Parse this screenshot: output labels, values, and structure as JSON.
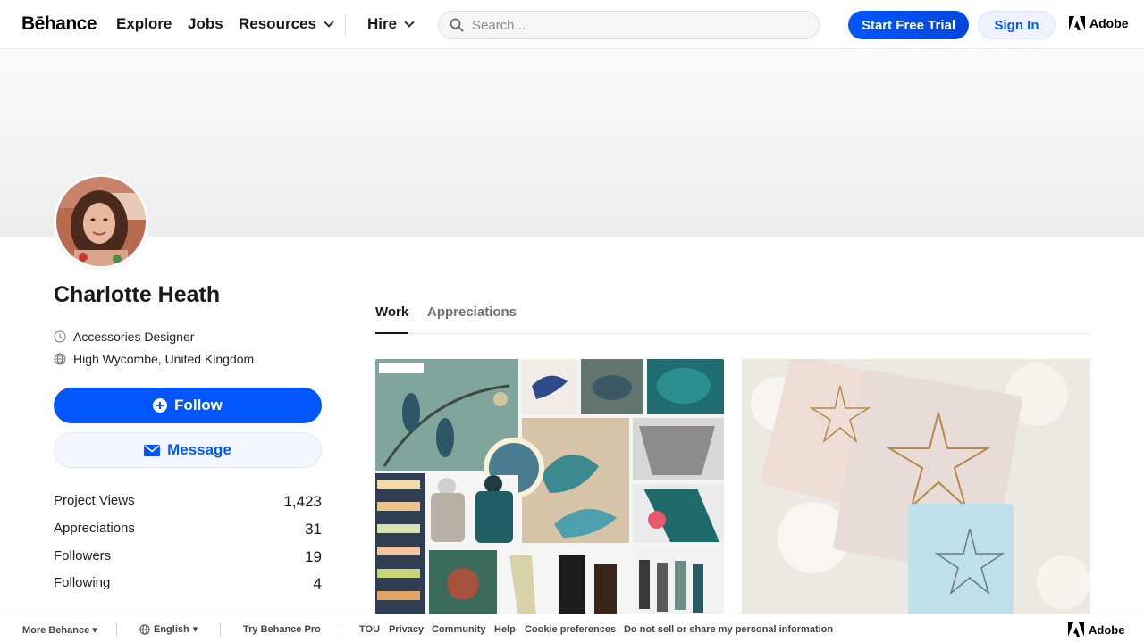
{
  "header": {
    "logo": "Bēhance",
    "nav": [
      "Explore",
      "Jobs",
      "Resources",
      "Hire"
    ],
    "search_placeholder": "Search...",
    "trial_label": "Start Free Trial",
    "signin_label": "Sign In",
    "adobe_label": "Adobe"
  },
  "profile": {
    "name": "Charlotte Heath",
    "occupation": "Accessories Designer",
    "location": "High Wycombe, United Kingdom",
    "follow_label": "Follow",
    "message_label": "Message",
    "stats": [
      {
        "label": "Project Views",
        "value": "1,423"
      },
      {
        "label": "Appreciations",
        "value": "31"
      },
      {
        "label": "Followers",
        "value": "19"
      },
      {
        "label": "Following",
        "value": "4"
      }
    ]
  },
  "tabs": [
    "Work",
    "Appreciations"
  ],
  "footer": {
    "items": [
      "More Behance",
      "English",
      "Try Behance Pro",
      "TOU",
      "Privacy",
      "Community",
      "Help",
      "Cookie preferences",
      "Do not sell or share my personal information"
    ],
    "adobe_label": "Adobe"
  },
  "colors": {
    "accent": "#0057ff",
    "banner": "#f2f2f2"
  }
}
